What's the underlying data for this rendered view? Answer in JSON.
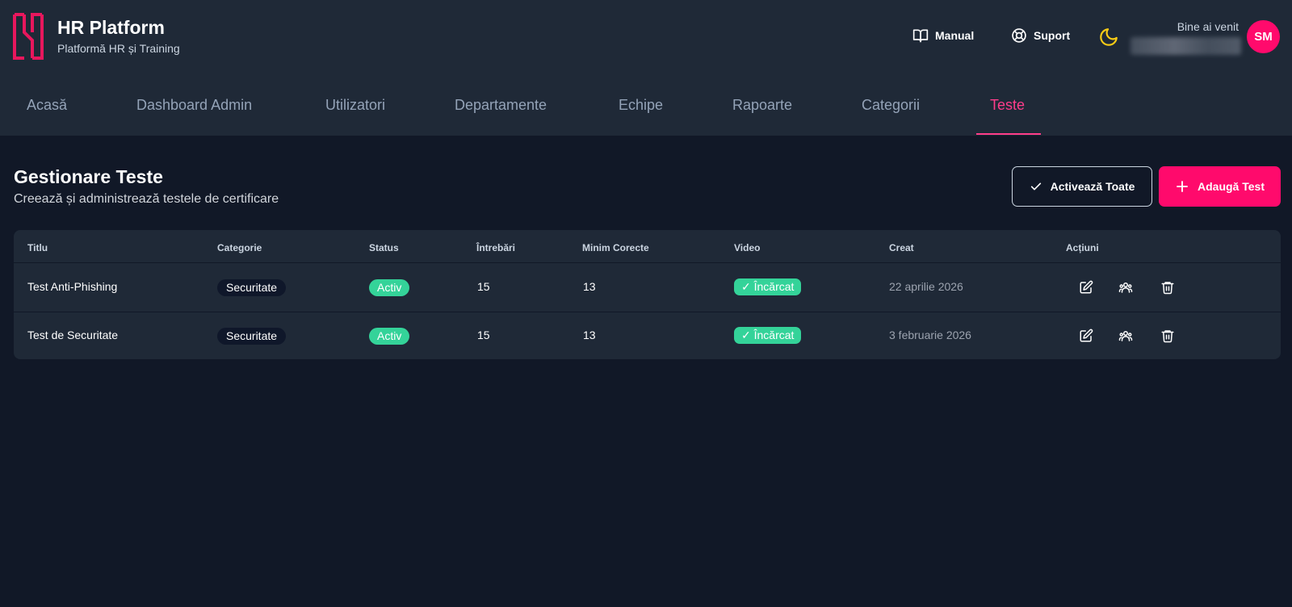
{
  "brand": {
    "title": "HR Platform",
    "subtitle": "Platformă HR și Training"
  },
  "header": {
    "manual_label": "Manual",
    "support_label": "Suport",
    "welcome": "Bine ai venit",
    "avatar_initials": "SM",
    "theme_icon": "moon-icon"
  },
  "nav": {
    "items": [
      {
        "label": "Acasă"
      },
      {
        "label": "Dashboard Admin"
      },
      {
        "label": "Utilizatori"
      },
      {
        "label": "Departamente"
      },
      {
        "label": "Echipe"
      },
      {
        "label": "Rapoarte"
      },
      {
        "label": "Categorii"
      },
      {
        "label": "Teste"
      }
    ],
    "active": "Teste"
  },
  "page": {
    "title": "Gestionare Teste",
    "subtitle": "Creează și administrează testele de certificare",
    "activate_all_label": "Activează Toate",
    "add_test_label": "Adaugă Test"
  },
  "table": {
    "headers": [
      "Titlu",
      "Categorie",
      "Status",
      "Întrebări",
      "Minim Corecte",
      "Video",
      "Creat",
      "Acțiuni"
    ],
    "rows": [
      {
        "title": "Test Anti-Phishing",
        "category": "Securitate",
        "status": "Activ",
        "questions": "15",
        "min_correct": "13",
        "video": "Încărcat",
        "created": "22 aprilie 2026"
      },
      {
        "title": "Test de Securitate",
        "category": "Securitate",
        "status": "Activ",
        "questions": "15",
        "min_correct": "13",
        "video": "Încărcat",
        "created": "3 februarie 2026"
      }
    ]
  },
  "colors": {
    "accent": "#ff0a6c",
    "active_nav": "#ff3d8b",
    "success": "#34d399",
    "header_bg": "#1f2937",
    "page_bg": "#111827"
  }
}
